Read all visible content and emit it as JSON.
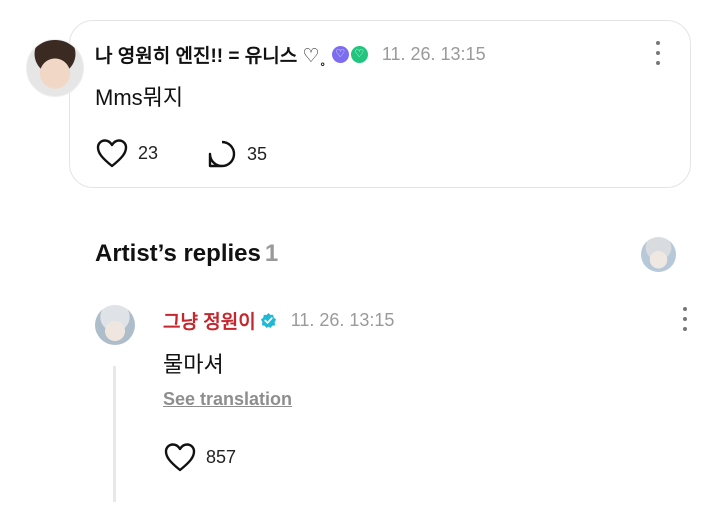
{
  "post": {
    "author": "나 영원히 엔진!! = 유니스 ♡˳",
    "timestamp": "11. 26. 13:15",
    "text": "Mms뭐지",
    "likes": "23",
    "comments": "35"
  },
  "artist_replies": {
    "title": "Artist’s replies",
    "count": "1"
  },
  "reply": {
    "author": "그냥 정원이",
    "timestamp": "11. 26. 13:15",
    "text": "물마셔",
    "see_translation": "See translation",
    "likes": "857"
  },
  "colors": {
    "artist_name": "#c4272e",
    "verified": "#1fb9d6",
    "badge_purple": "#7c6cf2",
    "badge_green": "#22c47e"
  }
}
